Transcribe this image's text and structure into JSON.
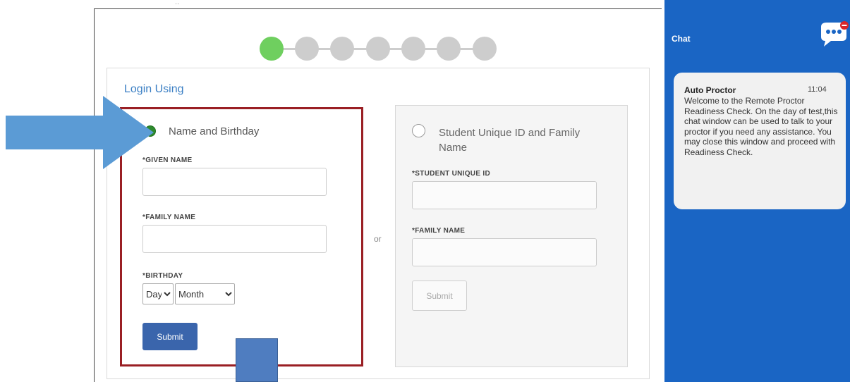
{
  "header": {
    "top_glyph": "··"
  },
  "steps": {
    "total": 7,
    "current": 1,
    "active_color": "#6fcf5f",
    "inactive_color": "#cdcdcd"
  },
  "login": {
    "title": "Login Using",
    "separator": "or",
    "option_name": {
      "label": "Name and Birthday",
      "selected": true,
      "given_name_label": "*GIVEN NAME",
      "given_name_value": "",
      "family_name_label": "*FAMILY NAME",
      "family_name_value": "",
      "birthday_label": "*BIRTHDAY",
      "day_select": "Day",
      "month_select": "Month",
      "submit_label": "Submit"
    },
    "option_id": {
      "label": "Student Unique ID and Family Name",
      "selected": false,
      "student_id_label": "*STUDENT UNIQUE ID",
      "student_id_value": "",
      "family_name_label": "*FAMILY NAME",
      "family_name_value": "",
      "submit_label": "Submit"
    }
  },
  "chat": {
    "title": "Chat",
    "icon": "chat-bubble-icon",
    "message": {
      "sender": "Auto Proctor",
      "time": "11:04",
      "text": "Welcome to the Remote Proctor Readiness Check. On the day of test,this chat window can be used to talk to your proctor if you need any assistance. You may close this window and proceed with Readiness Check."
    }
  },
  "colors": {
    "chat_bg": "#1a65c4",
    "selected_border": "#9a1f24",
    "submit_bg": "#3a65ac",
    "arrow": "#5b9bd5"
  }
}
